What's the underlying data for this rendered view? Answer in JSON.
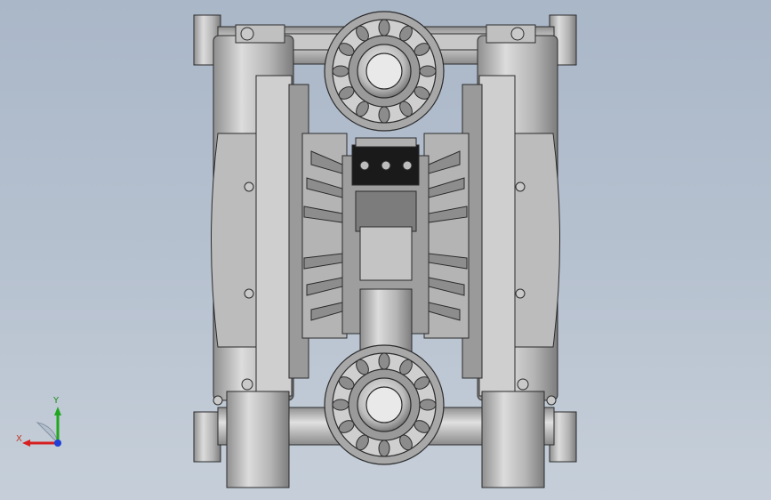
{
  "viewport": {
    "background_top": "#aab7c8",
    "background_bottom": "#c6cfd9",
    "model_name_icon": "diaphragm-pump-model",
    "colors": {
      "metal_light": "#d3d3d3",
      "metal_mid": "#a9a9a9",
      "metal_dark": "#6f6f6f",
      "edge": "#2b2b2b",
      "block": "#1a1a1a"
    }
  },
  "triad": {
    "x_label": "X",
    "y_label": "Y",
    "x_color": "#d62020",
    "y_color": "#1fa81f",
    "z_color": "#1f3fd6"
  }
}
